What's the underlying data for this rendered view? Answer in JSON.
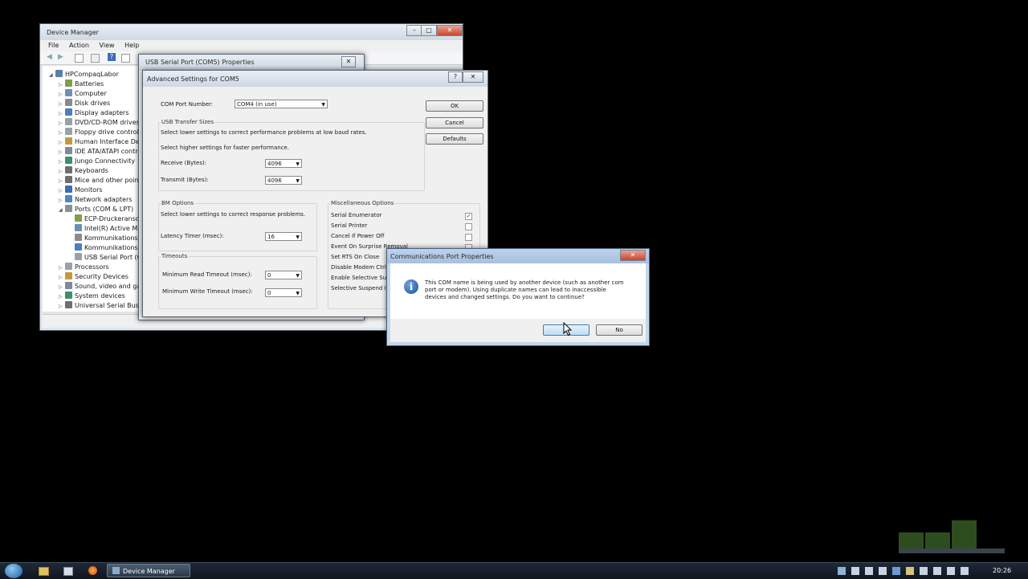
{
  "device_manager": {
    "title": "Device Manager",
    "menu": [
      "File",
      "Action",
      "View",
      "Help"
    ],
    "root": "HPCompaqLabor",
    "tree": [
      {
        "label": "Batteries",
        "level": 1
      },
      {
        "label": "Computer",
        "level": 1
      },
      {
        "label": "Disk drives",
        "level": 1
      },
      {
        "label": "Display adapters",
        "level": 1
      },
      {
        "label": "DVD/CD-ROM drives",
        "level": 1
      },
      {
        "label": "Floppy drive controll",
        "level": 1
      },
      {
        "label": "Human Interface Dev",
        "level": 1
      },
      {
        "label": "IDE ATA/ATAPI contro",
        "level": 1
      },
      {
        "label": "Jungo Connectivity",
        "level": 1
      },
      {
        "label": "Keyboards",
        "level": 1
      },
      {
        "label": "Mice and other point",
        "level": 1
      },
      {
        "label": "Monitors",
        "level": 1
      },
      {
        "label": "Network adapters",
        "level": 1
      },
      {
        "label": "Ports (COM & LPT)",
        "level": 1
      },
      {
        "label": "ECP-Druckeranso",
        "level": 2
      },
      {
        "label": "Intel(R) Active Ma",
        "level": 2
      },
      {
        "label": "Kommunikations",
        "level": 2
      },
      {
        "label": "Kommunikations",
        "level": 2
      },
      {
        "label": "USB Serial Port (C",
        "level": 2
      },
      {
        "label": "Processors",
        "level": 1
      },
      {
        "label": "Security Devices",
        "level": 1
      },
      {
        "label": "Sound, video and gar",
        "level": 1
      },
      {
        "label": "System devices",
        "level": 1
      },
      {
        "label": "Universal Serial Bus co",
        "level": 1
      }
    ]
  },
  "usb_props": {
    "title": "USB Serial Port (COM5) Properties"
  },
  "advanced": {
    "title": "Advanced Settings for COM5",
    "com_port_label": "COM Port Number:",
    "com_port_value": "COM4 (in use)",
    "usb_transfer": {
      "caption": "USB Transfer Sizes",
      "line1": "Select lower settings to correct performance problems at low baud rates.",
      "line2": "Select higher settings for faster performance.",
      "receive_label": "Receive (Bytes):",
      "receive_value": "4096",
      "transmit_label": "Transmit (Bytes):",
      "transmit_value": "4096"
    },
    "bm": {
      "caption": "BM Options",
      "line1": "Select lower settings to correct response problems.",
      "latency_label": "Latency Timer (msec):",
      "latency_value": "16"
    },
    "timeouts": {
      "caption": "Timeouts",
      "read_label": "Minimum Read Timeout (msec):",
      "read_value": "0",
      "write_label": "Minimum Write Timeout (msec):",
      "write_value": "0"
    },
    "misc": {
      "caption": "Miscellaneous Options",
      "options": [
        {
          "label": "Serial Enumerator",
          "checked": true
        },
        {
          "label": "Serial Printer",
          "checked": false
        },
        {
          "label": "Cancel If Power Off",
          "checked": false
        },
        {
          "label": "Event On Surprise Removal",
          "checked": false
        },
        {
          "label": "Set RTS On Close",
          "checked": false
        },
        {
          "label": "Disable Modem Ctrl A",
          "checked": false
        },
        {
          "label": "Enable Selective Susp",
          "checked": false
        },
        {
          "label": "Selective Suspend Idl",
          "checked": false
        }
      ]
    },
    "ok": "OK",
    "cancel": "Cancel",
    "defaults": "Defaults"
  },
  "msgbox": {
    "title": "Communications Port Properties",
    "message_line1": "This COM name is being used by another device (such as another com",
    "message_line2": "port or modem).  Using duplicate names can lead to inaccessible",
    "message_line3": "devices and changed settings.  Do you want to continue?",
    "yes": "",
    "no": "No"
  },
  "taskbar": {
    "task_label": "Device Manager",
    "clock": "20:26"
  },
  "colors": {
    "desktop": "#000000",
    "accent": "#2c6fbd",
    "close_red": "#c8452f"
  }
}
